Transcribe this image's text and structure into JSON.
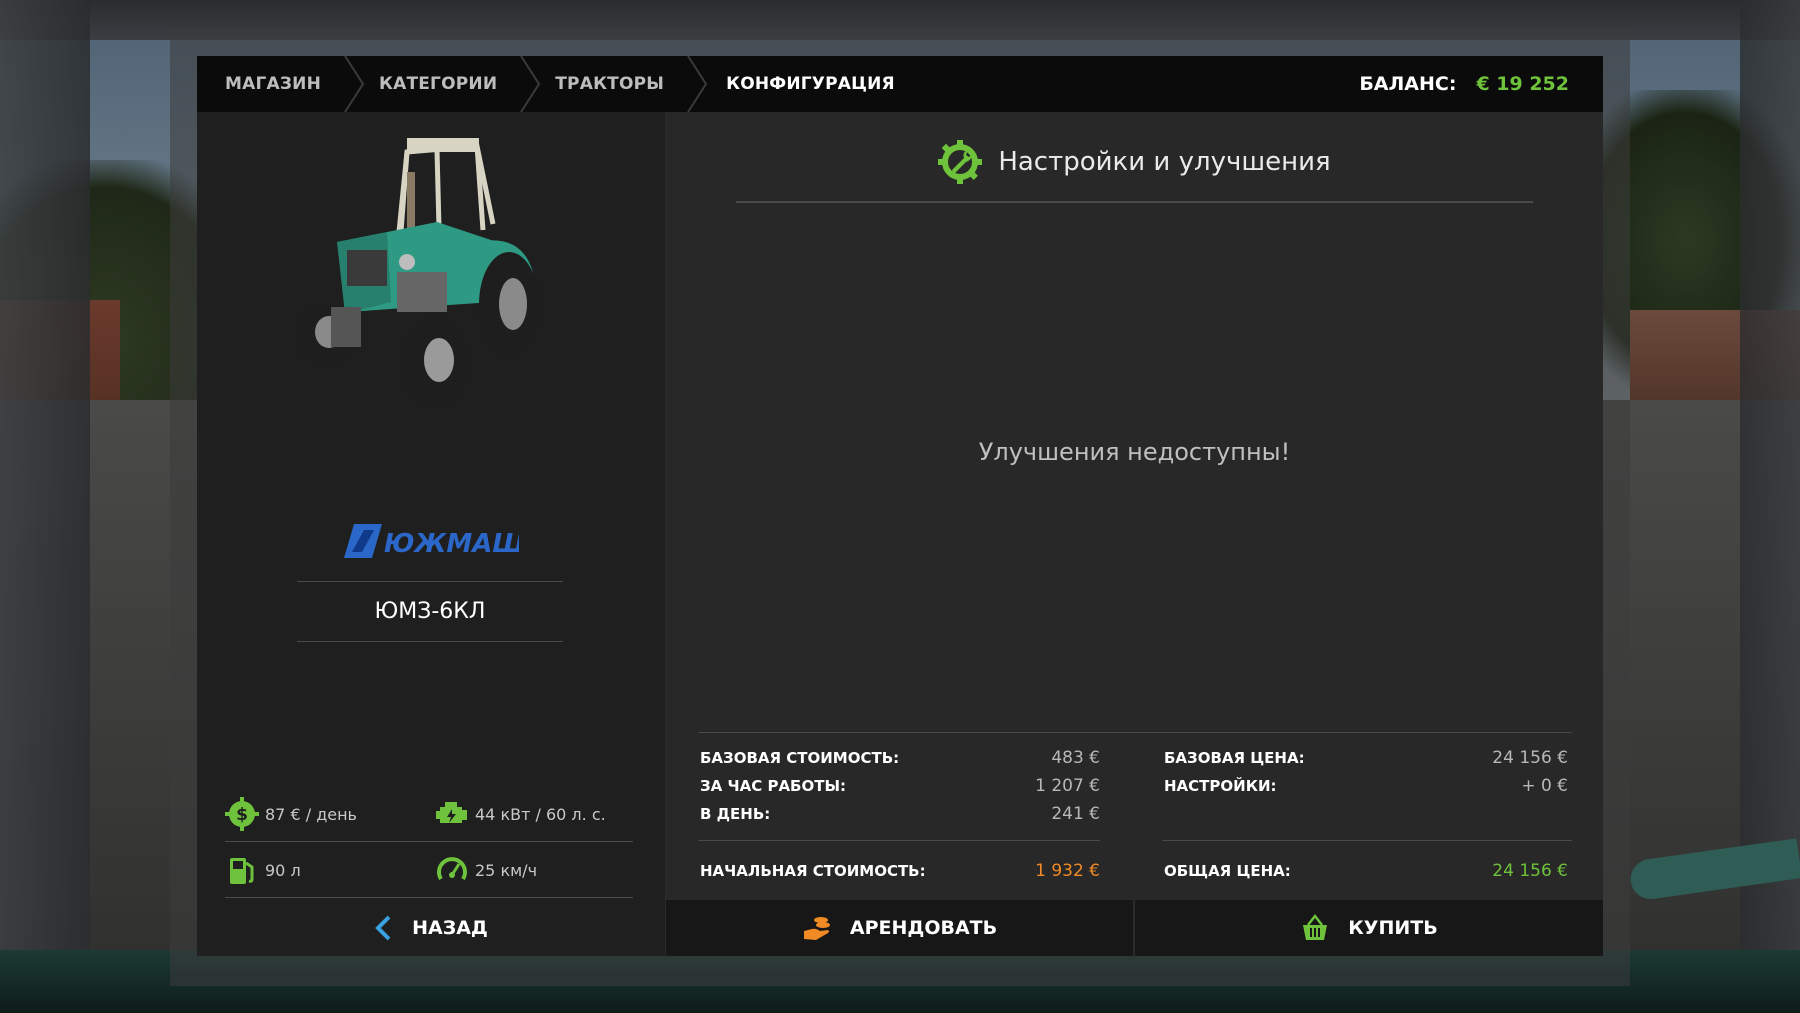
{
  "breadcrumbs": [
    {
      "label": "МАГАЗИН",
      "active": false
    },
    {
      "label": "КАТЕГОРИИ",
      "active": false
    },
    {
      "label": "ТРАКТОРЫ",
      "active": false
    },
    {
      "label": "КОНФИГУРАЦИЯ",
      "active": true
    }
  ],
  "balance": {
    "label": "БАЛАНС:",
    "value": "€ 19 252"
  },
  "vehicle": {
    "brand": "ЮЖМАШ",
    "model": "ЮМЗ-6КЛ",
    "specs": {
      "maintenance": "87 € / день",
      "power": "44 кВт / 60 л. с.",
      "fuel": "90 л",
      "speed": "25 км/ч"
    }
  },
  "settings": {
    "title": "Настройки и улучшения",
    "empty_message": "Улучшения недоступны!"
  },
  "lease_costs": {
    "base_cost": {
      "label": "БАЗОВАЯ СТОИМОСТЬ:",
      "value": "483 €"
    },
    "per_hour": {
      "label": "ЗА ЧАС РАБОТЫ:",
      "value": "1 207 €"
    },
    "per_day": {
      "label": "В ДЕНЬ:",
      "value": "241 €"
    },
    "initial": {
      "label": "НАЧАЛЬНАЯ СТОИМОСТЬ:",
      "value": "1 932 €"
    }
  },
  "purchase": {
    "base_price": {
      "label": "БАЗОВАЯ ЦЕНА:",
      "value": "24 156 €"
    },
    "options": {
      "label": "НАСТРОЙКИ:",
      "value": "+ 0 €"
    },
    "total": {
      "label": "ОБЩАЯ ЦЕНА:",
      "value": "24 156 €"
    }
  },
  "buttons": {
    "back": "НАЗАД",
    "lease": "АРЕНДОВАТЬ",
    "buy": "КУПИТЬ"
  },
  "colors": {
    "accent_green": "#6fc23b",
    "accent_orange": "#f08a24",
    "back_blue": "#3aa0e0",
    "panel_bg": "#2a2a2a"
  },
  "icons": {
    "settings": "wrench-gear-icon",
    "maintenance": "dollar-gear-icon",
    "power": "engine-icon",
    "fuel": "fuel-pump-icon",
    "speed": "speedometer-icon",
    "back": "chevron-left-icon",
    "lease": "hand-coins-icon",
    "buy": "basket-icon"
  }
}
